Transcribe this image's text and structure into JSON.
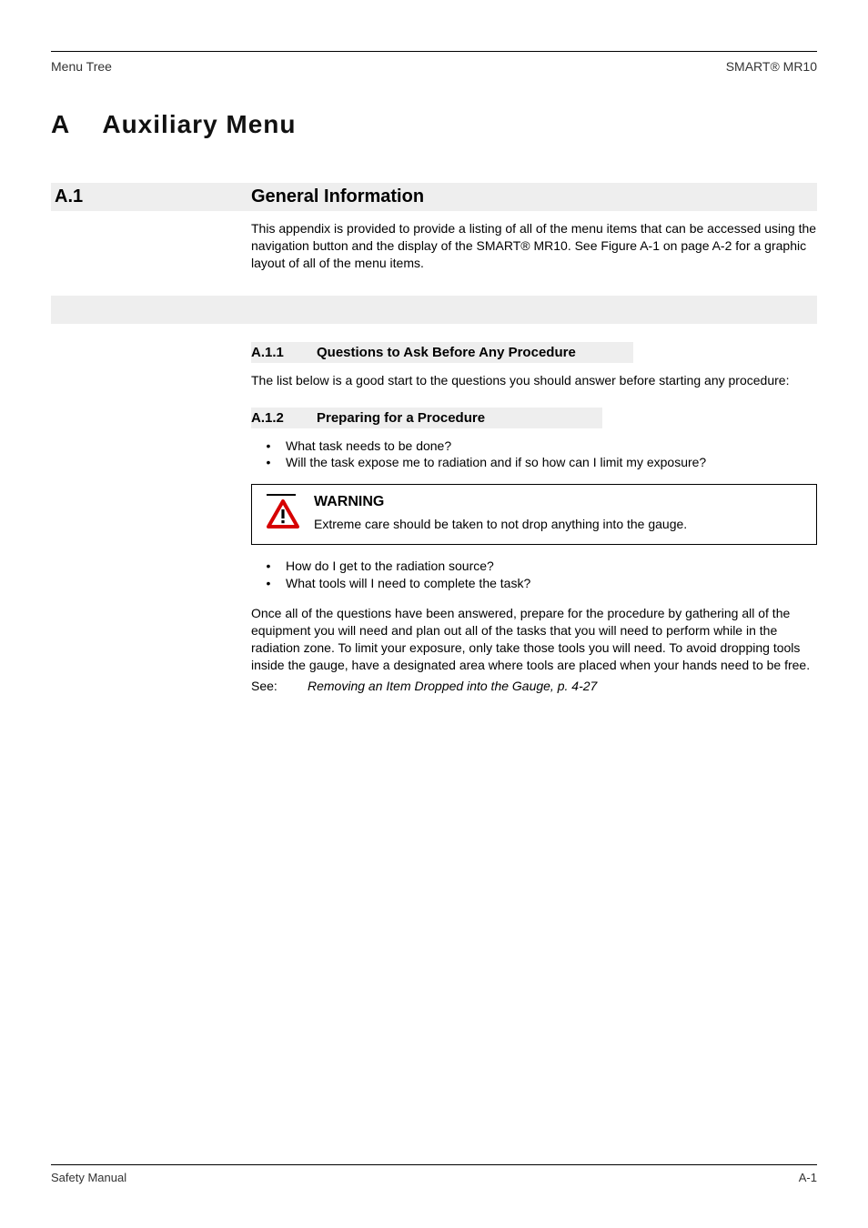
{
  "header": {
    "left": "Menu Tree",
    "right": "SMART® MR10"
  },
  "chapter": {
    "num": "A",
    "title": "Auxiliary Menu"
  },
  "section1": {
    "num": "A.1",
    "title": "General Information",
    "para": "This appendix is provided to provide a listing of all of the menu items that can be accessed using the navigation button and the display of the SMART® MR10. See Figure A-1 on page A-2 for a graphic layout of all of the menu items."
  },
  "sub1": {
    "num": "A.1.1",
    "title": "Questions to Ask Before Any Procedure",
    "lead": "The list below is a good start to the questions you should answer before starting any procedure:",
    "items": [
      "What task needs to be done?",
      "Will the task expose me to radiation and if so how can I limit my exposure?",
      "How do I get to the radiation source?",
      "What tools will I need to complete the task?"
    ]
  },
  "sub2": {
    "num": "A.1.2",
    "title": "Preparing for a Procedure",
    "para": "Once all of the questions have been answered, prepare for the procedure by gathering all of the equipment you will need and plan out all of the tasks that you will need to perform while in the radiation zone. To limit your exposure, only take those tools you will need. To avoid dropping tools inside the gauge, have a designated area where tools are placed when your hands need to be free."
  },
  "warning": {
    "title": "WARNING",
    "body": "Extreme care should be taken to not drop anything into the gauge."
  },
  "see": {
    "label": "See:",
    "body": "Removing an Item Dropped into the Gauge, p. 4-27"
  },
  "footer": {
    "left": "Safety Manual",
    "right": "A-1"
  }
}
